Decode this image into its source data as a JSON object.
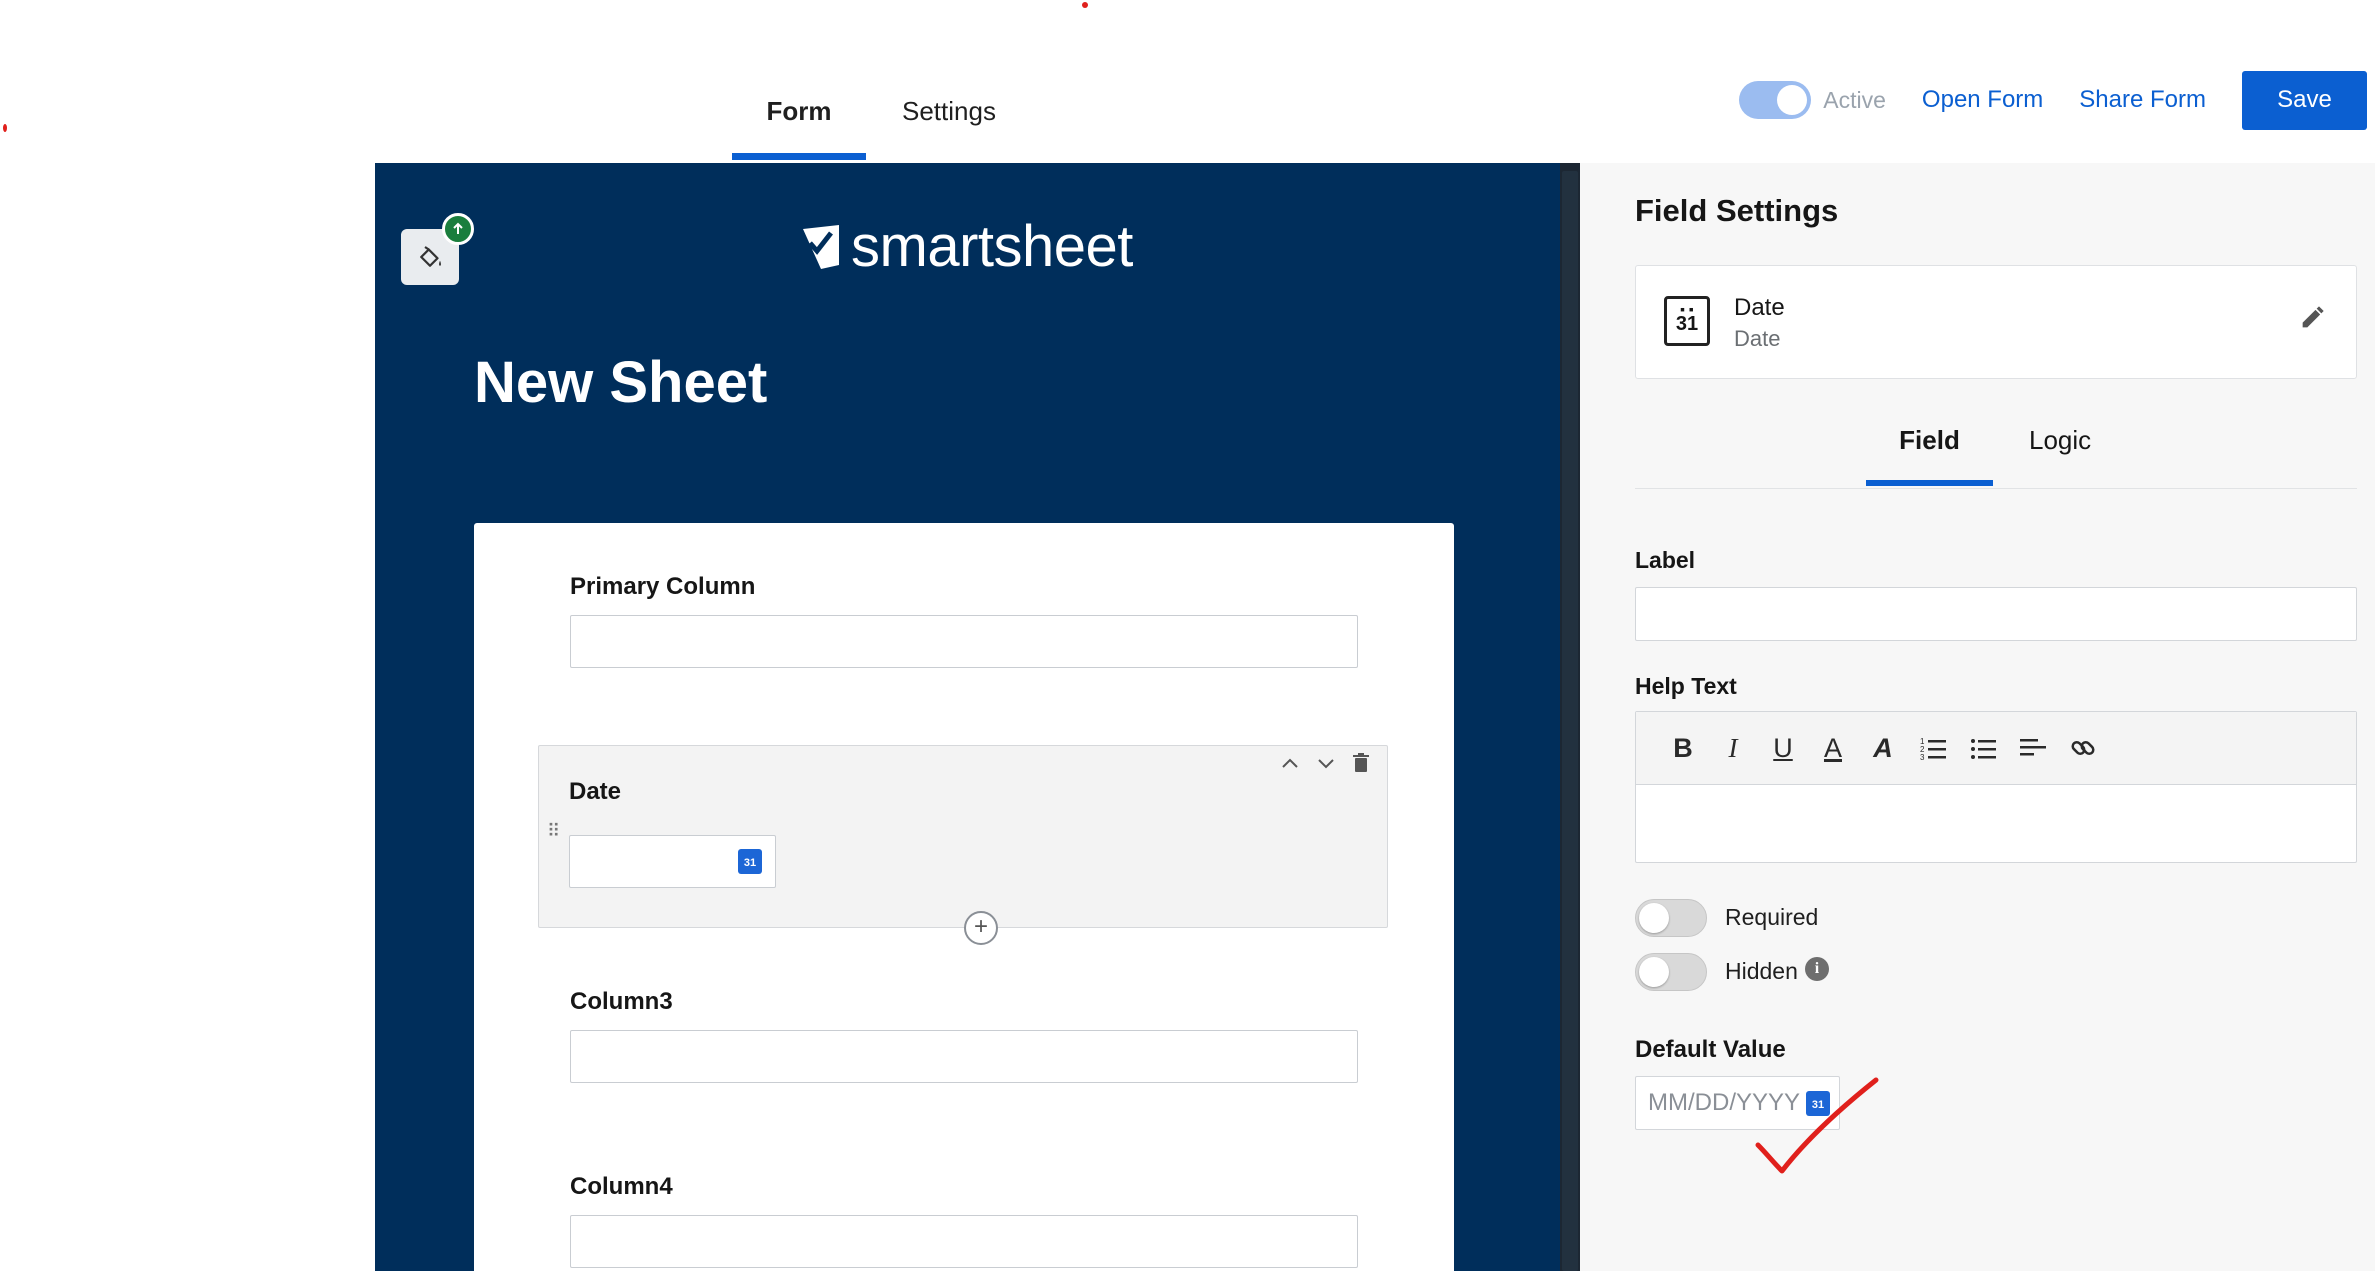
{
  "top_tabs": [
    {
      "label": "Form",
      "active": true
    },
    {
      "label": "Settings",
      "active": false
    }
  ],
  "header_actions": {
    "active_label": "Active",
    "active_on": true,
    "open_form": "Open Form",
    "share_form": "Share Form",
    "save": "Save"
  },
  "form": {
    "logo_text": "smartsheet",
    "title": "New Sheet",
    "fields": [
      {
        "label": "Primary Column"
      },
      {
        "label": "Date",
        "calendar_day": "31"
      },
      {
        "label": "Column3"
      },
      {
        "label": "Column4"
      }
    ],
    "add_symbol": "+"
  },
  "panel": {
    "title": "Field Settings",
    "field_card": {
      "name": "Date",
      "type": "Date",
      "icon_day": "31"
    },
    "tabs": [
      {
        "label": "Field",
        "active": true
      },
      {
        "label": "Logic",
        "active": false
      }
    ],
    "label_heading": "Label",
    "help_text_heading": "Help Text",
    "toolbar": {
      "bold": "B",
      "italic": "I",
      "underline": "U",
      "font_color": "A",
      "highlight": "A"
    },
    "required": {
      "label": "Required",
      "on": false
    },
    "hidden": {
      "label": "Hidden",
      "on": false
    },
    "info_symbol": "i",
    "default_value_heading": "Default Value",
    "default_value_placeholder": "MM/DD/YYYY",
    "calendar_day": "31"
  },
  "colors": {
    "brand_blue": "#0b5fd1",
    "canvas_navy": "#002e5b",
    "badge_green": "#1a7e3d",
    "annotation_red": "#e0201c"
  }
}
